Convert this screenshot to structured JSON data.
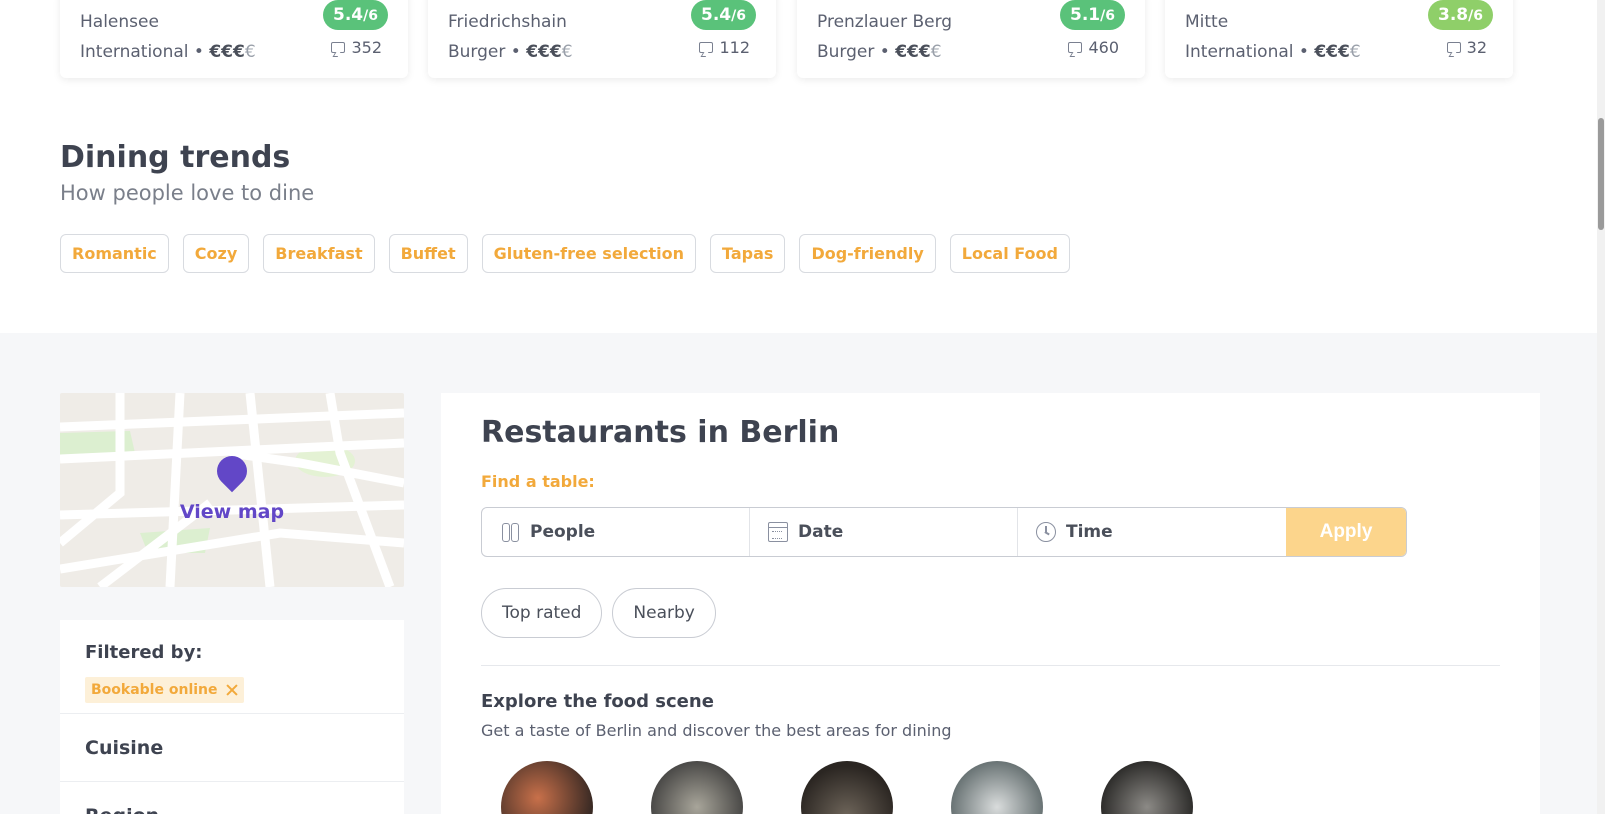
{
  "cards": [
    {
      "area": "Halensee",
      "cuisine": "International",
      "price_on": "€€€",
      "price_off": "€",
      "rating": "5.4",
      "rating_scale": "/6",
      "reviews": "352"
    },
    {
      "area": "Friedrichshain",
      "cuisine": "Burger",
      "price_on": "€€€",
      "price_off": "€",
      "rating": "5.4",
      "rating_scale": "/6",
      "reviews": "112"
    },
    {
      "area": "Prenzlauer Berg",
      "cuisine": "Burger",
      "price_on": "€€€",
      "price_off": "€",
      "rating": "5.1",
      "rating_scale": "/6",
      "reviews": "460"
    },
    {
      "area": "Mitte",
      "cuisine": "International",
      "price_on": "€€€",
      "price_off": "€",
      "rating": "3.8",
      "rating_scale": "/6",
      "reviews": "32"
    }
  ],
  "separator": "•",
  "trends": {
    "title": "Dining trends",
    "subtitle": "How people love to dine",
    "tags": [
      "Romantic",
      "Cozy",
      "Breakfast",
      "Buffet",
      "Gluten-free selection",
      "Tapas",
      "Dog-friendly",
      "Local Food"
    ]
  },
  "map": {
    "label": "View map"
  },
  "filters": {
    "title": "Filtered by:",
    "active_chip": "Bookable online",
    "sections": [
      "Cuisine",
      "Region"
    ]
  },
  "main": {
    "title": "Restaurants in Berlin",
    "find_label": "Find a table:",
    "people": "People",
    "date": "Date",
    "time": "Time",
    "apply": "Apply",
    "pills": [
      "Top rated",
      "Nearby"
    ],
    "explore_title": "Explore the food scene",
    "explore_subtitle": "Get a taste of Berlin and discover the best areas for dining"
  },
  "colors": {
    "accent": "#f2a93b",
    "brand": "#6247c7",
    "rating_green": "#5ac27a",
    "rating_light_green": "#8fcf69",
    "apply_bg": "#fcd58c"
  }
}
